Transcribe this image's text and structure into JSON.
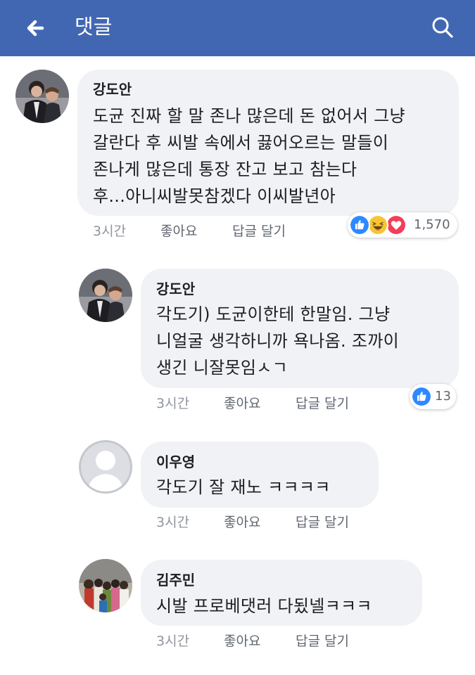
{
  "header": {
    "title": "댓글",
    "background": "#4267b2",
    "back_icon": "arrow-left-icon",
    "search_icon": "search-icon"
  },
  "comments": [
    {
      "author": "강도안",
      "lines": [
        "도균 진짜 할 말 존나 많은데 돈 없어서 그냥",
        "갈란다 후 씨발 속에서 끓어오르는 말들이",
        "존나게 많은데 통장 잔고 보고 참는다",
        "후...아니씨발못참겠다 이씨발년아"
      ],
      "time": "3시간",
      "like": "좋아요",
      "reply": "답글 달기",
      "reactions": [
        "like-icon",
        "haha-icon",
        "love-icon"
      ],
      "reaction_count": "1,570"
    },
    {
      "author": "강도안",
      "lines": [
        "각도기) 도균이한테 한말임. 그냥",
        "니얼굴 생각하니까 욕나옴. 조까이",
        "생긴 니잘못임ㅅㄱ"
      ],
      "time": "3시간",
      "like": "좋아요",
      "reply": "답글 달기",
      "reactions": [
        "like-icon"
      ],
      "reaction_count": "13"
    },
    {
      "author": "이우영",
      "lines": [
        "각도기 잘 재노 ㅋㅋㅋㅋ"
      ],
      "time": "3시간",
      "like": "좋아요",
      "reply": "답글 달기"
    },
    {
      "author": "김주민",
      "lines": [
        "시발 프로베댓러 다됬넬ㅋㅋㅋ"
      ],
      "time": "3시간",
      "like": "좋아요",
      "reply": "답글 달기"
    }
  ]
}
